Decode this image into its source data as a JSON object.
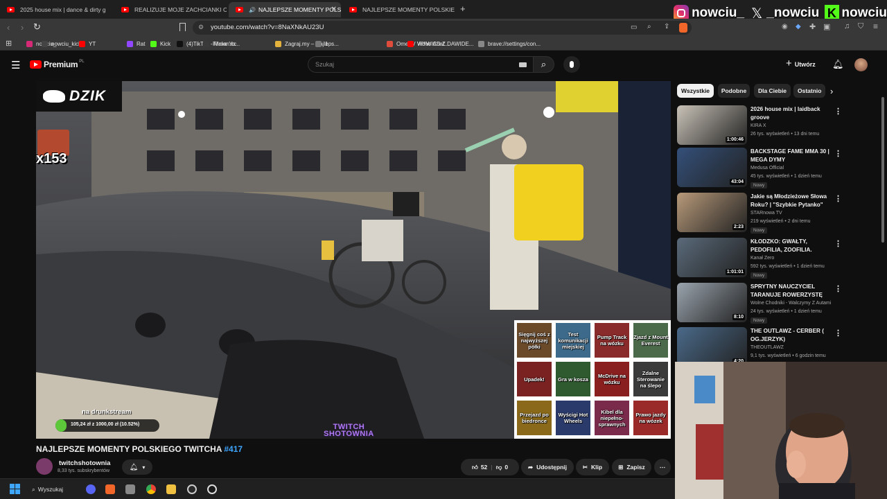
{
  "browser": {
    "tabs": [
      {
        "title": "2025 house mix | dance & dirty g"
      },
      {
        "title": "REALIZUJE MOJE ZACHCIANKI CIĄŻC"
      },
      {
        "title": "NAJLEPSZE MOMENTY POLSK"
      },
      {
        "title": "NAJLEPSZE MOMENTY POLSKIEGO T"
      }
    ],
    "new_tab": "+",
    "url": "youtube.com/watch?v=8NaXNkAU23U",
    "bookmarks": [
      {
        "label": "nowciu_",
        "color": "#d62976"
      },
      {
        "label": "nowciu_kick",
        "color": "#444444"
      },
      {
        "label": "YT",
        "color": "#ff0000"
      },
      {
        "label": "Rat",
        "color": "#9146ff"
      },
      {
        "label": "Kick",
        "color": "#53fc18"
      },
      {
        "label": "(4)TikTok - Make Yo...",
        "color": "#111111"
      },
      {
        "label": "Filman.cc",
        "color": "#3a3a3a"
      },
      {
        "label": "Zagraj.my – Najleps...",
        "color": "#e3b23c"
      },
      {
        "label": "1",
        "color": "#777777"
      },
      {
        "label": "OmeTV Video Chat...",
        "color": "#e04c3c"
      },
      {
        "label": "WYWIAD Z DAWIDE...",
        "color": "#ff0000"
      },
      {
        "label": "brave://settings/con...",
        "color": "#888888"
      }
    ]
  },
  "overlay": {
    "social": [
      {
        "name": "instagram-icon",
        "handle": "nowciu_"
      },
      {
        "name": "x-icon",
        "handle": "_nowciu"
      },
      {
        "name": "kick-icon",
        "handle": "nowciu"
      }
    ]
  },
  "youtube": {
    "logo_text": "Premium",
    "logo_region": "PL",
    "search_placeholder": "Szukaj",
    "create_label": "Utwórz",
    "chips": [
      "Wszystkie",
      "Podobne",
      "Dla Ciebie",
      "Ostatnio"
    ],
    "video": {
      "title": "NAJLEPSZE MOMENTY POLSKIEGO TWITCHA",
      "hashtag": "#417",
      "channel": "twitchshotownia",
      "subscribers": "8,33 tys. subskrybentów",
      "likes": "52",
      "dislikes": "0",
      "share": "Udostępnij",
      "clip": "Klip",
      "save": "Zapisz"
    },
    "player_overlay": {
      "brand": "DZIK",
      "combo": "x153",
      "drunkstream_label": "na drunkstream",
      "goal_text": "105,24 zł z 1000,00 zł (10.52%)",
      "goal_fraction": 0.1052,
      "watermark_line1": "TWITCH",
      "watermark_line2": "SHOTOWNIA",
      "tiles": [
        {
          "text": "Sięgnij coś z najwyższej półki",
          "color": "#6b4a2a"
        },
        {
          "text": "Test komunikacji miejskiej",
          "color": "#3d6a8a"
        },
        {
          "text": "Pump Track na wózku",
          "color": "#8a2b2b"
        },
        {
          "text": "Zjazd z Mount Everest",
          "color": "#4a6a4a"
        },
        {
          "text": "Upadek!",
          "color": "#7a2222"
        },
        {
          "text": "Gra w kosza",
          "color": "#2f5a2f"
        },
        {
          "text": "McDrive na wózku",
          "color": "#8a1f1f"
        },
        {
          "text": "Zdalne Sterowanie na ślepo",
          "color": "#3a3a3a"
        },
        {
          "text": "Przejazd po biedronce",
          "color": "#8a6a1a"
        },
        {
          "text": "Wyścigi Hot Wheels",
          "color": "#2a3a6a"
        },
        {
          "text": "Kibel dla niepełno-sprawnych",
          "color": "#7a2a4a"
        },
        {
          "text": "Prawo jazdy na wózek",
          "color": "#9a2a2a"
        }
      ]
    },
    "recommendations": [
      {
        "title": "2026 house mix | laidback groove",
        "channel": "KIRA X",
        "meta": "26 tys. wyświetleń • 13 dni temu",
        "duration": "1:00:46",
        "badge": "",
        "thumb": "#c9c2b8"
      },
      {
        "title": "BACKSTAGE FAME MMA 30 | MEGA DYMY",
        "channel": "Medusa Official",
        "meta": "45 tys. wyświetleń • 1 dzień temu",
        "duration": "43:04",
        "badge": "Nowy",
        "thumb": "#34507a"
      },
      {
        "title": "Jakie są Młodzieżowe Słowa Roku? | \"Szybkie Pytanko\" (odc...",
        "channel": "STARnowa TV",
        "meta": "219 wyświetleń • 2 dni temu",
        "duration": "2:23",
        "badge": "Nowy",
        "thumb": "#b89a7a"
      },
      {
        "title": "KŁODZKO: GWAŁTY, PEDOFILIA, ZOOFILIA. WSTRZĄSAJĄCE ...",
        "channel": "Kanał Zero",
        "meta": "592 tys. wyświetleń • 1 dzień temu",
        "duration": "1:01:01",
        "badge": "Nowy",
        "thumb": "#5a6a7a"
      },
      {
        "title": "SPRYTNY NAUCZYCIEL TARANUJE ROWERZYSTĘ PO...",
        "channel": "Wolne Chodniki - Walczymy Z Autami",
        "meta": "24 tys. wyświetleń • 1 dzień temu",
        "duration": "8:10",
        "badge": "Nowy",
        "thumb": "#9aa4ae"
      },
      {
        "title": "THE OUTLAWZ - CERBER ( OG.JERZYK)",
        "channel": "THEOUTLAWZ",
        "meta": "9,1 tys. wyświetleń • 6 godzin temu",
        "duration": "4:20",
        "badge": "",
        "thumb": "#4a6a8a"
      }
    ]
  },
  "taskbar": {
    "search_label": "Wyszukaj"
  }
}
